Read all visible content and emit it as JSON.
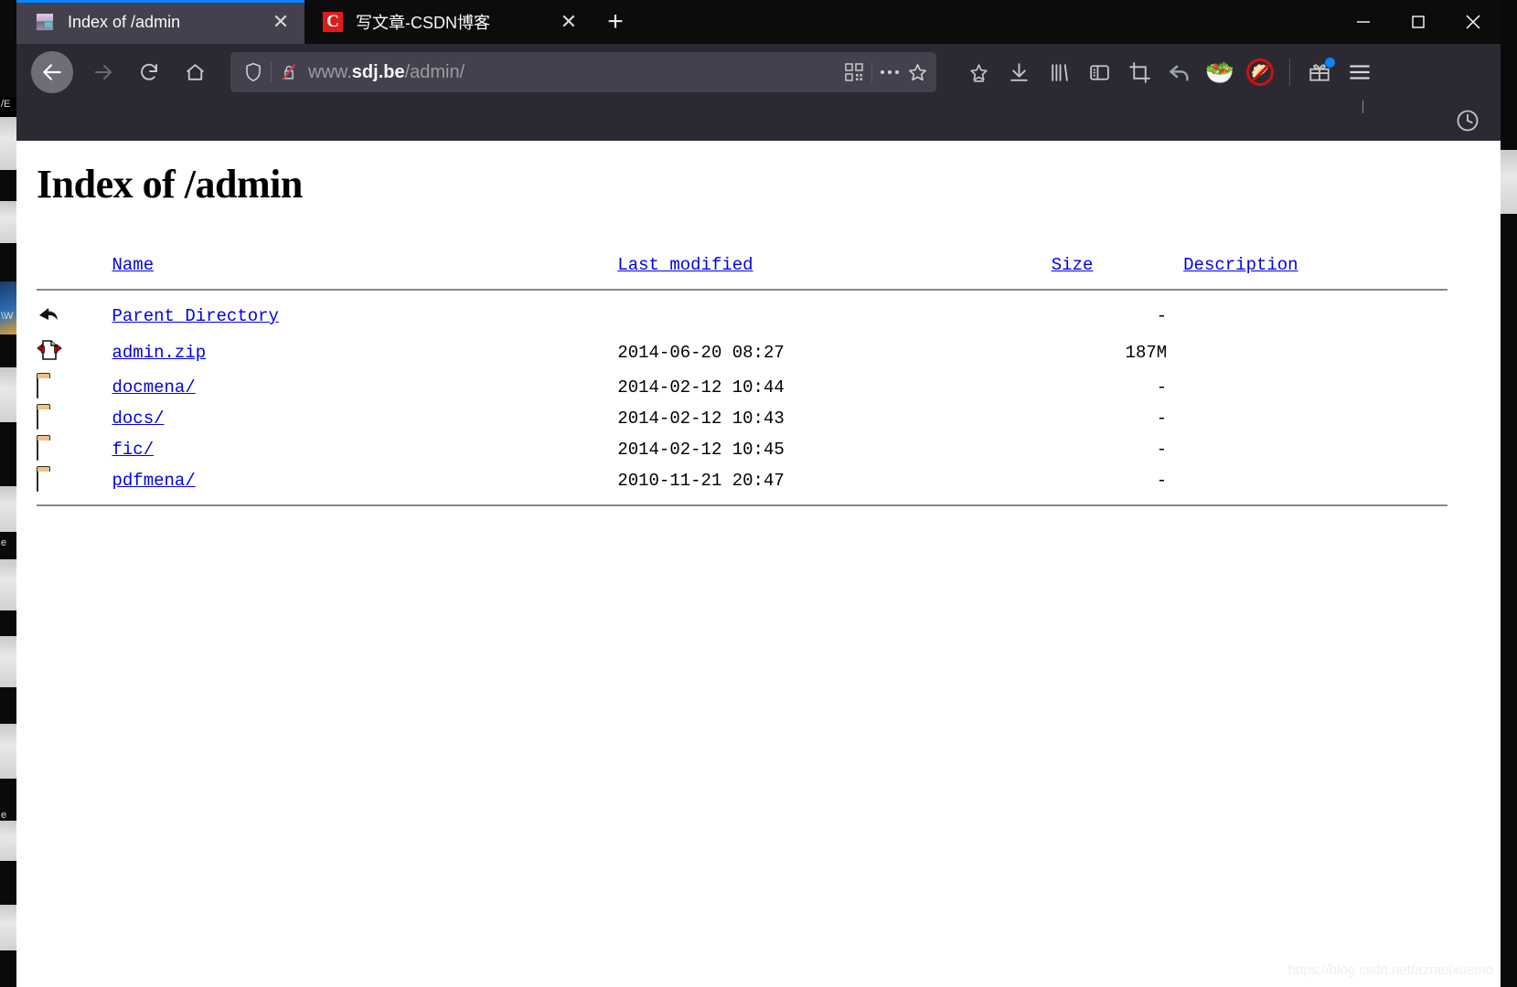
{
  "window": {
    "controls": {
      "minimize": "—",
      "maximize": "□",
      "close": "✕"
    }
  },
  "tabs": [
    {
      "title": "Index of /admin",
      "favicon": "server-favicon",
      "active": true,
      "close_label": "✕"
    },
    {
      "title": "写文章-CSDN博客",
      "favicon": "csdn-favicon",
      "active": false,
      "close_label": "✕",
      "favicon_letter": "C"
    }
  ],
  "newtab_label": "+",
  "toolbar": {
    "back_icon": "back-arrow-icon",
    "forward_icon": "forward-arrow-icon",
    "reload_icon": "reload-icon",
    "home_icon": "home-icon",
    "url": {
      "shield_icon": "tracking-protection-shield-icon",
      "insecure_icon": "insecure-connection-icon",
      "www": "www.",
      "host": "sdj.be",
      "path": "/admin/",
      "qr_icon": "qr-code-icon",
      "more_icon": "page-actions-more-icon",
      "bookmark_icon": "bookmark-star-icon"
    },
    "icons": [
      {
        "name": "save-to-pocket-icon",
        "glyph": "☆"
      },
      {
        "name": "downloads-icon",
        "glyph": "⬇"
      },
      {
        "name": "library-icon",
        "glyph": "‖‖"
      },
      {
        "name": "sidebar-toggle-icon",
        "glyph": "◫"
      },
      {
        "name": "screenshot-crop-icon",
        "glyph": "⛶"
      },
      {
        "name": "undo-close-tab-icon",
        "glyph": "↩"
      },
      {
        "name": "fruit-bowl-extension-icon",
        "glyph": "🥗"
      },
      {
        "name": "block-extension-icon",
        "glyph": "🥟"
      }
    ],
    "gift_icon": "gift-promo-icon",
    "menu_icon": "app-menu-icon",
    "history_icon": "history-clock-icon"
  },
  "page": {
    "title": "Index of /admin",
    "columns": [
      {
        "key": "name",
        "label": "Name"
      },
      {
        "key": "modified",
        "label": "Last modified"
      },
      {
        "key": "size",
        "label": "Size"
      },
      {
        "key": "description",
        "label": "Description"
      }
    ],
    "rows": [
      {
        "icon": "parent-directory-icon",
        "name": "Parent Directory",
        "modified": "",
        "size": "-",
        "description": ""
      },
      {
        "icon": "zip-file-icon",
        "name": "admin.zip",
        "modified": "2014-06-20 08:27",
        "size": "187M",
        "description": ""
      },
      {
        "icon": "folder-icon",
        "name": "docmena/",
        "modified": "2014-02-12 10:44",
        "size": "-",
        "description": ""
      },
      {
        "icon": "folder-icon",
        "name": "docs/",
        "modified": "2014-02-12 10:43",
        "size": "-",
        "description": ""
      },
      {
        "icon": "folder-icon",
        "name": "fic/",
        "modified": "2014-02-12 10:45",
        "size": "-",
        "description": ""
      },
      {
        "icon": "folder-icon",
        "name": "pdfmena/",
        "modified": "2010-11-21 20:47",
        "size": "-",
        "description": ""
      }
    ],
    "watermark": "https://blog.csdn.net/azraelxuemo"
  },
  "colors": {
    "tab_active_bg": "#42414d",
    "tabstrip_bg": "#0c0c0d",
    "toolbar_bg": "#2b2a33",
    "accent": "#0a84ff",
    "link": "#0000ee",
    "page_bg": "#ffffff"
  }
}
